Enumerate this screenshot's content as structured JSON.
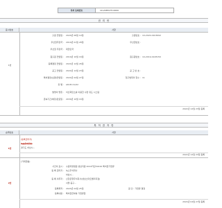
{
  "header": {
    "reg_no_label": "특허 등록번호",
    "reg_no_value": "10-2483175-0000"
  },
  "section1": {
    "title": "권 리 란",
    "col_num": "표시번호",
    "col_content": "사항",
    "row_label": "1번",
    "fields": [
      {
        "label": "출원 연월일 :",
        "value": "2020년 08월 19일",
        "label2": "출원번호 :",
        "value2": "10-2020-0103692"
      },
      {
        "label": "우선권주장국 :",
        "value": "2019년 01월 28일",
        "label2": "우선권번호 :",
        "value2": ""
      },
      {
        "label": "우선권 주장국 :",
        "value": "대한민국",
        "label2": "",
        "value2": ""
      },
      {
        "label": "원출원 연월일 :",
        "value": "2019년 10월 16일",
        "label2": "원출원번호 :",
        "value2": "10-2019-0128150"
      },
      {
        "label": "등록결정 연월일 :",
        "value": "2022년 12월 26일",
        "label2": "",
        "value2": ""
      },
      {
        "label": "공고 연월일 :",
        "value": "2022년 12월 23일",
        "label2": "공 고 번 호 :",
        "value2": ""
      },
      {
        "label": "특허결정(심결)연월일 :",
        "value": "2022년 04월 27일",
        "label2": "청구범위의 항수 :",
        "value2": "11"
      },
      {
        "label": "유 별 :",
        "value": "A61M 21/02",
        "label2": "",
        "value2": ""
      },
      {
        "label": "발명의 명칭 :",
        "value": "이산화탄소를 이용한 수면 유도 시스템",
        "label2": "",
        "value2": ""
      },
      {
        "label": "존속기간(예정)만료일 :",
        "value": "2039년 10월 16일",
        "label2": "",
        "value2": ""
      }
    ],
    "date": "2022년 12월 23일 등록"
  },
  "section2": {
    "title": "특 허 권 자 란",
    "col_num": "순위번호",
    "col_content": "사항",
    "rows": [
      {
        "label": "1번",
        "line1": "(등록권리자)",
        "line2": "녹스주식회사",
        "line3": "경기도 하남시...",
        "date": "2022년 12월 23일 등록"
      },
      {
        "label": "2번",
        "line1": "(거래현황)",
        "fields": [
          {
            "label": "사건의 표시 :",
            "value": "수원지방법원 성남지원 2024카단50016 특허권가압류"
          },
          {
            "label": "등 록 권리자 :",
            "value": "녹스주식회사"
          },
          {
            "label": "",
            "value": "하남시..."
          },
          {
            "label": "등 록 의무자 :",
            "value": "신한은행주식회사(성남스마트밸리지점)"
          },
          {
            "label": "",
            "value": "서울 중구..."
          },
          {
            "label": "등록목적 :",
            "value": "2024년 04월 25일",
            "value2": "원 인 : 가압류 결정"
          },
          {
            "label": "등록내용 :",
            "value": "특허권전부를 가압류함"
          }
        ],
        "date": "2024년 04월 27일 등록"
      }
    ]
  }
}
